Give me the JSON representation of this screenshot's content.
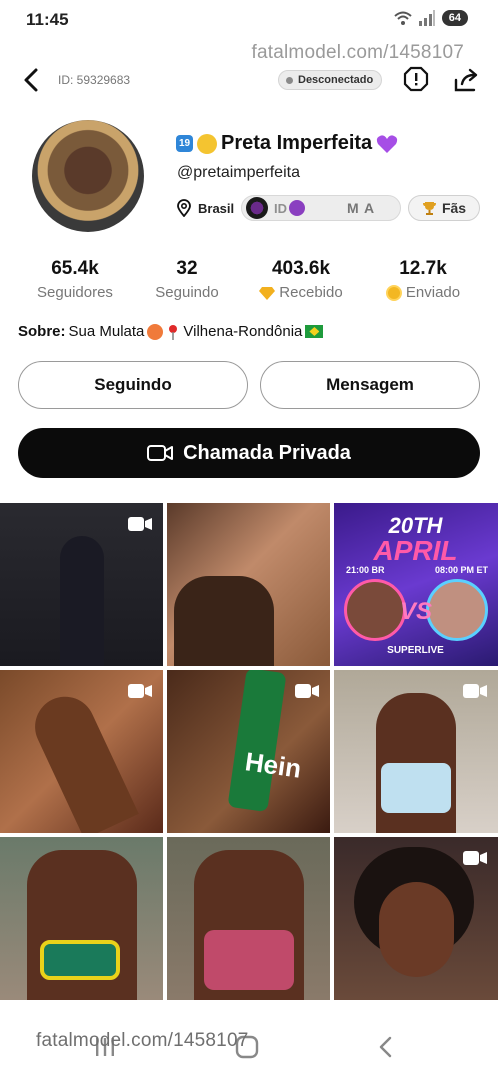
{
  "status_bar": {
    "time": "11:45",
    "battery": "64"
  },
  "watermark": "fatalmodel.com/1458107",
  "header": {
    "profile_id": "ID: 59329683",
    "connection_status": "Desconectado"
  },
  "profile": {
    "level": "19",
    "display_name": "Preta Imperfeita",
    "username": "@pretaimperfeita",
    "country": "Brasil",
    "pill_text_1": "ID",
    "pill_text_2": "M A",
    "fans_label": "Fãs"
  },
  "stats": [
    {
      "value": "65.4k",
      "label": "Seguidores"
    },
    {
      "value": "32",
      "label": "Seguindo"
    },
    {
      "value": "403.6k",
      "label": "Recebido"
    },
    {
      "value": "12.7k",
      "label": "Enviado"
    }
  ],
  "about": {
    "label": "Sobre:",
    "text_1": "Sua Mulata",
    "text_2": "Vilhena-Rondônia"
  },
  "buttons": {
    "following": "Seguindo",
    "message": "Mensagem",
    "private_call": "Chamada Privada"
  },
  "promo": {
    "date": "20TH",
    "month": "APRIL",
    "time_left": "21:00 BR",
    "time_right": "08:00 PM ET",
    "vs": "VS",
    "footer": "SUPERLIVE"
  },
  "media_tile_6_bottle": "Hein",
  "icons": [
    "back-icon",
    "report-icon",
    "share-icon",
    "pin-icon",
    "trophy-icon",
    "diamond-icon",
    "coin-icon",
    "video-icon",
    "camera-icon"
  ]
}
